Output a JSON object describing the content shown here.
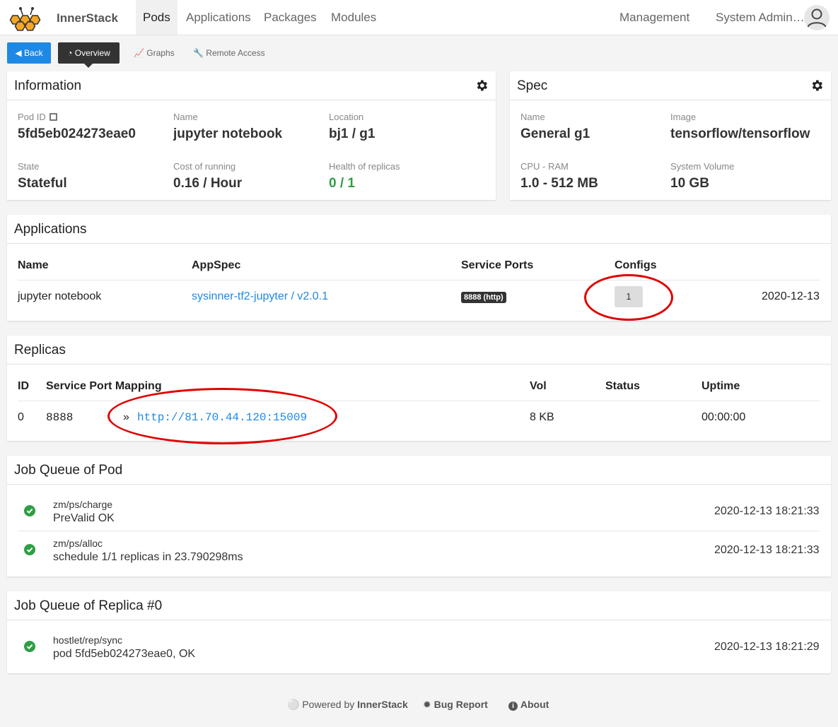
{
  "nav": {
    "brand": "InnerStack",
    "links": [
      "Pods",
      "Applications",
      "Packages",
      "Modules"
    ],
    "management": "Management",
    "user": "System Admin…"
  },
  "subnav": {
    "back": "Back",
    "overview": "Overview",
    "graphs": "Graphs",
    "remote": "Remote Access"
  },
  "information": {
    "title": "Information",
    "fields": [
      {
        "label": "Pod ID",
        "value": "5fd5eb024273eae0"
      },
      {
        "label": "Name",
        "value": "jupyter notebook"
      },
      {
        "label": "Location",
        "value": "bj1 / g1"
      },
      {
        "label": "State",
        "value": "Stateful"
      },
      {
        "label": "Cost of running",
        "value": "0.16 / Hour"
      },
      {
        "label": "Health of replicas",
        "value": "0 / 1"
      }
    ]
  },
  "spec": {
    "title": "Spec",
    "fields": [
      {
        "label": "Name",
        "value": "General g1"
      },
      {
        "label": "Image",
        "value": "tensorflow/tensorflow"
      },
      {
        "label": "CPU - RAM",
        "value": "1.0 - 512 MB"
      },
      {
        "label": "System Volume",
        "value": "10 GB"
      }
    ]
  },
  "applications": {
    "title": "Applications",
    "headers": [
      "Name",
      "AppSpec",
      "Service Ports",
      "Configs"
    ],
    "rows": [
      {
        "name": "jupyter notebook",
        "appspec": "sysinner-tf2-jupyter / v2.0.1",
        "port": "8888 (http)",
        "configs": "1",
        "date": "2020-12-13"
      }
    ]
  },
  "replicas": {
    "title": "Replicas",
    "headers": [
      "ID",
      "Service Port Mapping",
      "Vol",
      "Status",
      "Uptime"
    ],
    "rows": [
      {
        "id": "0",
        "port": "8888",
        "arrow": "»",
        "url": "http://81.70.44.120:15009",
        "vol": "8 KB",
        "status": "",
        "uptime": "00:00:00"
      }
    ]
  },
  "job_pod": {
    "title": "Job Queue of Pod",
    "items": [
      {
        "name": "zm/ps/charge",
        "msg": "PreValid OK",
        "time": "2020-12-13 18:21:33"
      },
      {
        "name": "zm/ps/alloc",
        "msg": "schedule 1/1 replicas in 23.790298ms",
        "time": "2020-12-13 18:21:33"
      }
    ]
  },
  "job_replica": {
    "title": "Job Queue of Replica #0",
    "items": [
      {
        "name": "hostlet/rep/sync",
        "msg": "pod 5fd5eb024273eae0, OK",
        "time": "2020-12-13 18:21:29"
      }
    ]
  },
  "footer": {
    "powered": "Powered by",
    "brand": "InnerStack",
    "bug": "Bug Report",
    "about": "About"
  },
  "colors": {
    "accent": "#1e88e5",
    "success": "#2e9e44",
    "annotation": "#e00000"
  }
}
